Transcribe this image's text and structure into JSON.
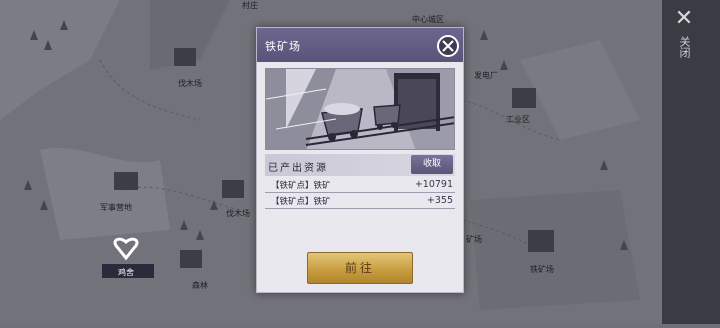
{
  "map": {
    "labels": {
      "village": "村庄",
      "center_city": "中心城区",
      "lumberyard_1": "伐木场",
      "power_plant": "发电厂",
      "industrial_zone": "工业区",
      "military_camp": "军事营地",
      "lumberyard_2": "伐木场",
      "mine_1": "矿场",
      "ore_mine": "铁矿场",
      "chicken_coop": "鸡舍",
      "forest": "森林"
    }
  },
  "sidebar": {
    "close_label": "关闭"
  },
  "dialog": {
    "title": "铁矿场",
    "produced_label": "已产出资源",
    "collect_label": "收取",
    "resources": [
      {
        "name": "【铁矿点】铁矿",
        "amount": "+10791"
      },
      {
        "name": "【铁矿点】铁矿",
        "amount": "+355"
      }
    ],
    "go_label": "前往"
  },
  "colors": {
    "header": "#5a5379",
    "collect_button": "#5b5478",
    "go_button": "#c79b3c",
    "map_bg": "#6f6f77"
  }
}
